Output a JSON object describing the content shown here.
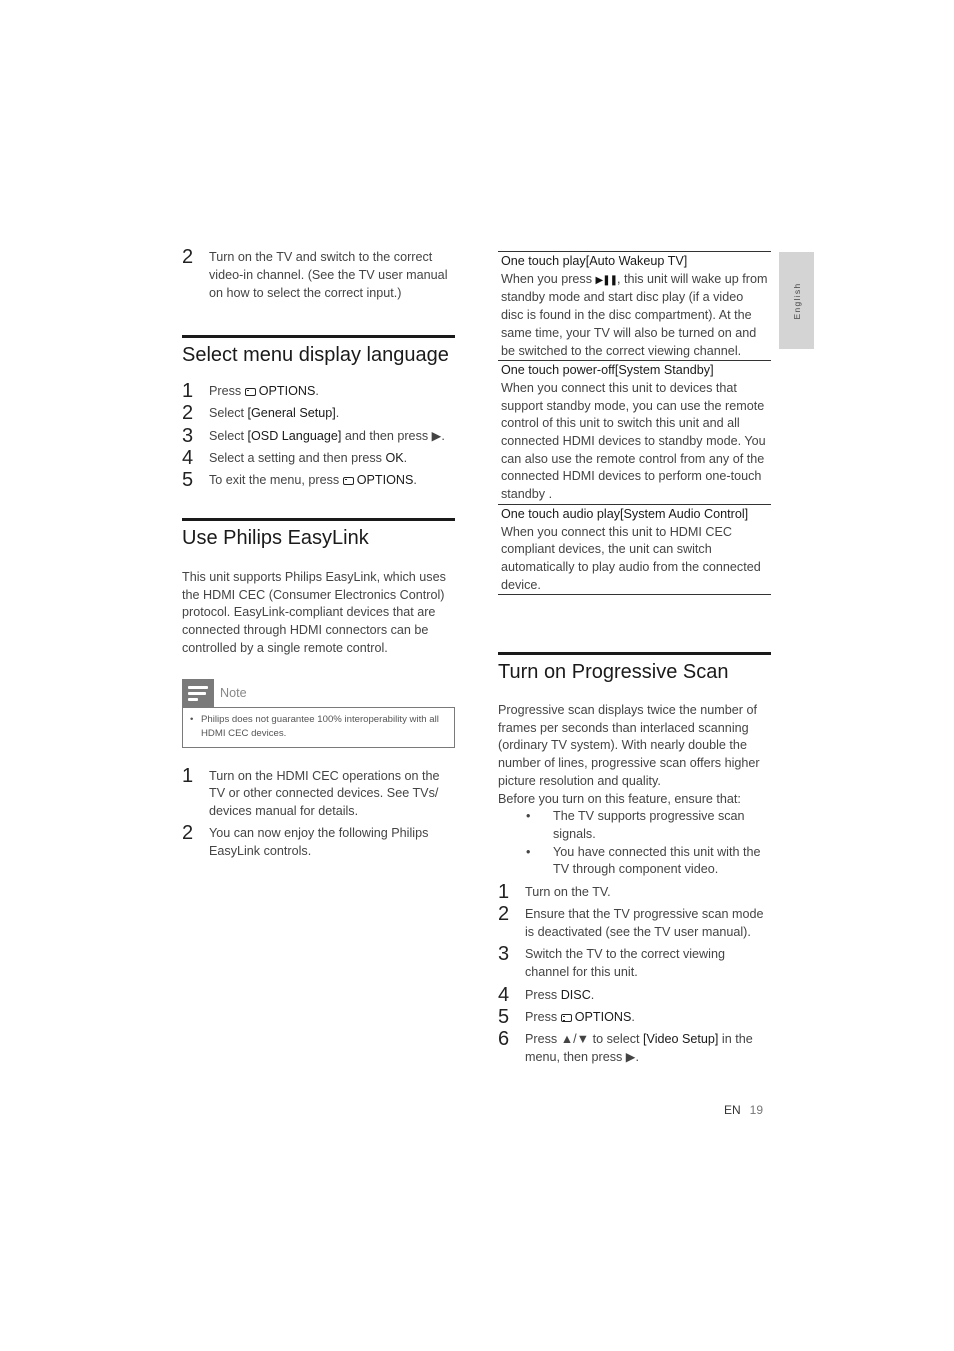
{
  "side_tab": {
    "label": "English"
  },
  "left": {
    "intro_step": {
      "num": "2",
      "text": "Turn on the TV and switch to the correct video-in channel. (See the TV user manual on how to select the correct input.)"
    },
    "section_language": {
      "title": "Select menu display language",
      "steps": [
        {
          "num": "1",
          "pre": "Press ",
          "icon": "options-icon",
          "bold": "OPTIONS",
          "post": "."
        },
        {
          "num": "2",
          "pre": "Select ",
          "bold": "[General Setup]",
          "post": "."
        },
        {
          "num": "3",
          "pre": "Select ",
          "bold": "[OSD Language]",
          "post": " and then press ▶."
        },
        {
          "num": "4",
          "pre": "Select a setting and then press ",
          "bold": "OK",
          "post": "."
        },
        {
          "num": "5",
          "pre": "To exit the menu, press ",
          "icon": "options-icon",
          "bold": "OPTIONS",
          "post": "."
        }
      ]
    },
    "section_easylink": {
      "title": "Use Philips EasyLink",
      "intro": "This unit supports Philips EasyLink, which uses the HDMI CEC (Consumer Electronics Control) protocol. EasyLink-compliant devices that are connected through HDMI connectors can be controlled by a single remote control.",
      "note": {
        "label": "Note",
        "bullet": "•",
        "text": "Philips does not guarantee 100% interoperability with all HDMI CEC devices."
      },
      "steps": [
        {
          "num": "1",
          "text": "Turn on the HDMI CEC operations on the TV or other connected devices. See TVs/ devices manual for details."
        },
        {
          "num": "2",
          "text": "You can now enjoy the following Philips EasyLink controls."
        }
      ]
    }
  },
  "right": {
    "features": [
      {
        "title": "One touch play[Auto Wakeup TV]",
        "pre": "When you press ",
        "symbol": "▶❚❚",
        "text": ", this unit will wake up from standby mode and start disc play (if a video disc is found in the disc compartment). At the same time, your TV will also be turned on and be switched to the correct viewing channel."
      },
      {
        "title": "One touch power-off[System Standby]",
        "text": "When you connect this unit to devices that support standby mode, you can use the remote control of this unit to switch this unit and all connected HDMI devices to standby mode. You can also use the remote control from any of the connected HDMI devices to perform one-touch standby ."
      },
      {
        "title": "One touch audio play[System Audio Control]",
        "text": "When you connect this unit to HDMI CEC compliant devices, the unit can switch automatically to play audio from the connected device."
      }
    ],
    "section_progressive": {
      "title": "Turn on Progressive Scan",
      "intro": "Progressive scan displays twice the number of frames per seconds than interlaced scanning (ordinary TV system). With nearly double the number of lines, progressive scan offers higher picture resolution and quality.",
      "ensure": "Before you turn on this feature, ensure that:",
      "bullets": [
        "The TV supports progressive scan signals.",
        "You have connected this unit with the TV through component video."
      ],
      "steps": [
        {
          "num": "1",
          "pre": "Turn on the TV."
        },
        {
          "num": "2",
          "pre": "Ensure that the TV progressive scan mode is deactivated (see the TV user manual)."
        },
        {
          "num": "3",
          "pre": "Switch the TV to the correct viewing channel for this unit."
        },
        {
          "num": "4",
          "pre": "Press ",
          "bold": "DISC",
          "post": "."
        },
        {
          "num": "5",
          "pre": "Press ",
          "icon": "options-icon",
          "bold": "OPTIONS",
          "post": "."
        },
        {
          "num": "6",
          "pre": "Press ▲/▼ to select ",
          "bold": "[Video Setup]",
          "post": " in the menu, then press ▶."
        }
      ]
    }
  },
  "footer": {
    "lang": "EN",
    "page": "19"
  }
}
